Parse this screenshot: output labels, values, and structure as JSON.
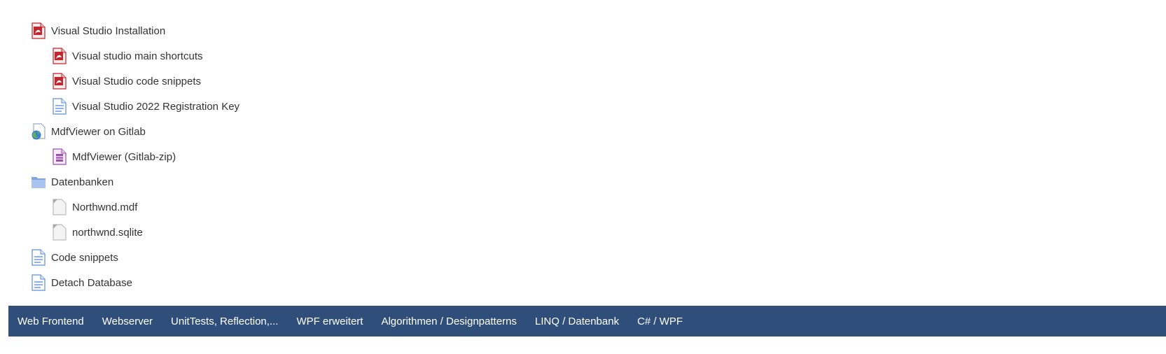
{
  "tree": {
    "items": [
      {
        "label": "Visual Studio Installation",
        "icon": "pdf-icon",
        "level": 0
      },
      {
        "label": "Visual studio main shortcuts",
        "icon": "pdf-icon",
        "level": 1
      },
      {
        "label": "Visual Studio code snippets",
        "icon": "pdf-icon",
        "level": 1
      },
      {
        "label": "Visual Studio 2022 Registration Key",
        "icon": "page-icon",
        "level": 1
      },
      {
        "label": "MdfViewer on Gitlab",
        "icon": "url-icon",
        "level": 0
      },
      {
        "label": "MdfViewer (Gitlab-zip)",
        "icon": "archive-icon",
        "level": 1
      },
      {
        "label": "Datenbanken",
        "icon": "folder-icon",
        "level": 0
      },
      {
        "label": "Northwnd.mdf",
        "icon": "file-icon",
        "level": 1
      },
      {
        "label": "northwnd.sqlite",
        "icon": "file-icon",
        "level": 1
      },
      {
        "label": "Code snippets",
        "icon": "page-icon",
        "level": 0
      },
      {
        "label": "Detach Database",
        "icon": "page-icon",
        "level": 0
      }
    ]
  },
  "navbar": {
    "items": [
      "Web Frontend",
      "Webserver",
      "UnitTests, Reflection,...",
      "WPF erweitert",
      "Algorithmen / Designpatterns",
      "LINQ / Datenbank",
      "C# / WPF"
    ]
  },
  "colors": {
    "navbar_bg": "#2f4f7a",
    "text": "#333333",
    "pdf_red": "#c0262d"
  }
}
